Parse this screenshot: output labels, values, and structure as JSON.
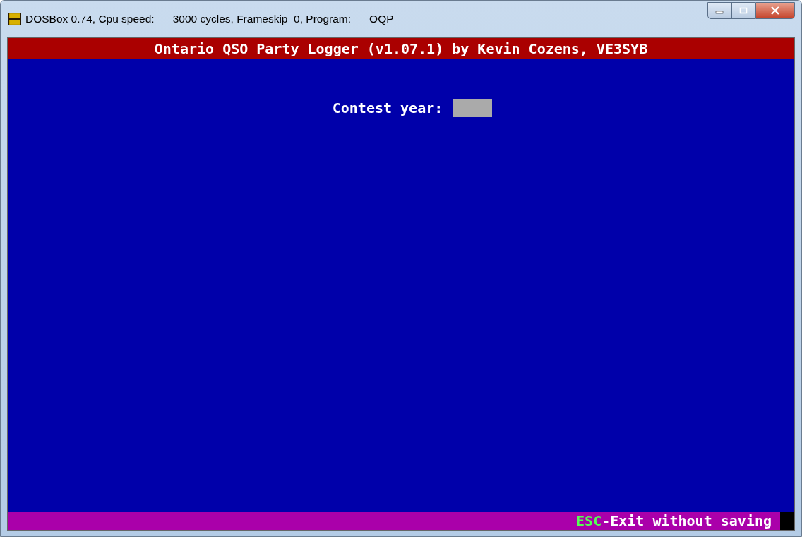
{
  "window": {
    "title": "DOSBox 0.74, Cpu speed:",
    "cpu_cycles": "3000 cycles, Frameskip  0, Program:",
    "program": "OQP"
  },
  "header": {
    "title": "Ontario QSO Party Logger (v1.07.1) by Kevin Cozens, VE3SYB"
  },
  "form": {
    "label": "Contest year:"
  },
  "footer": {
    "key": "ESC",
    "hint": "-Exit without saving"
  }
}
